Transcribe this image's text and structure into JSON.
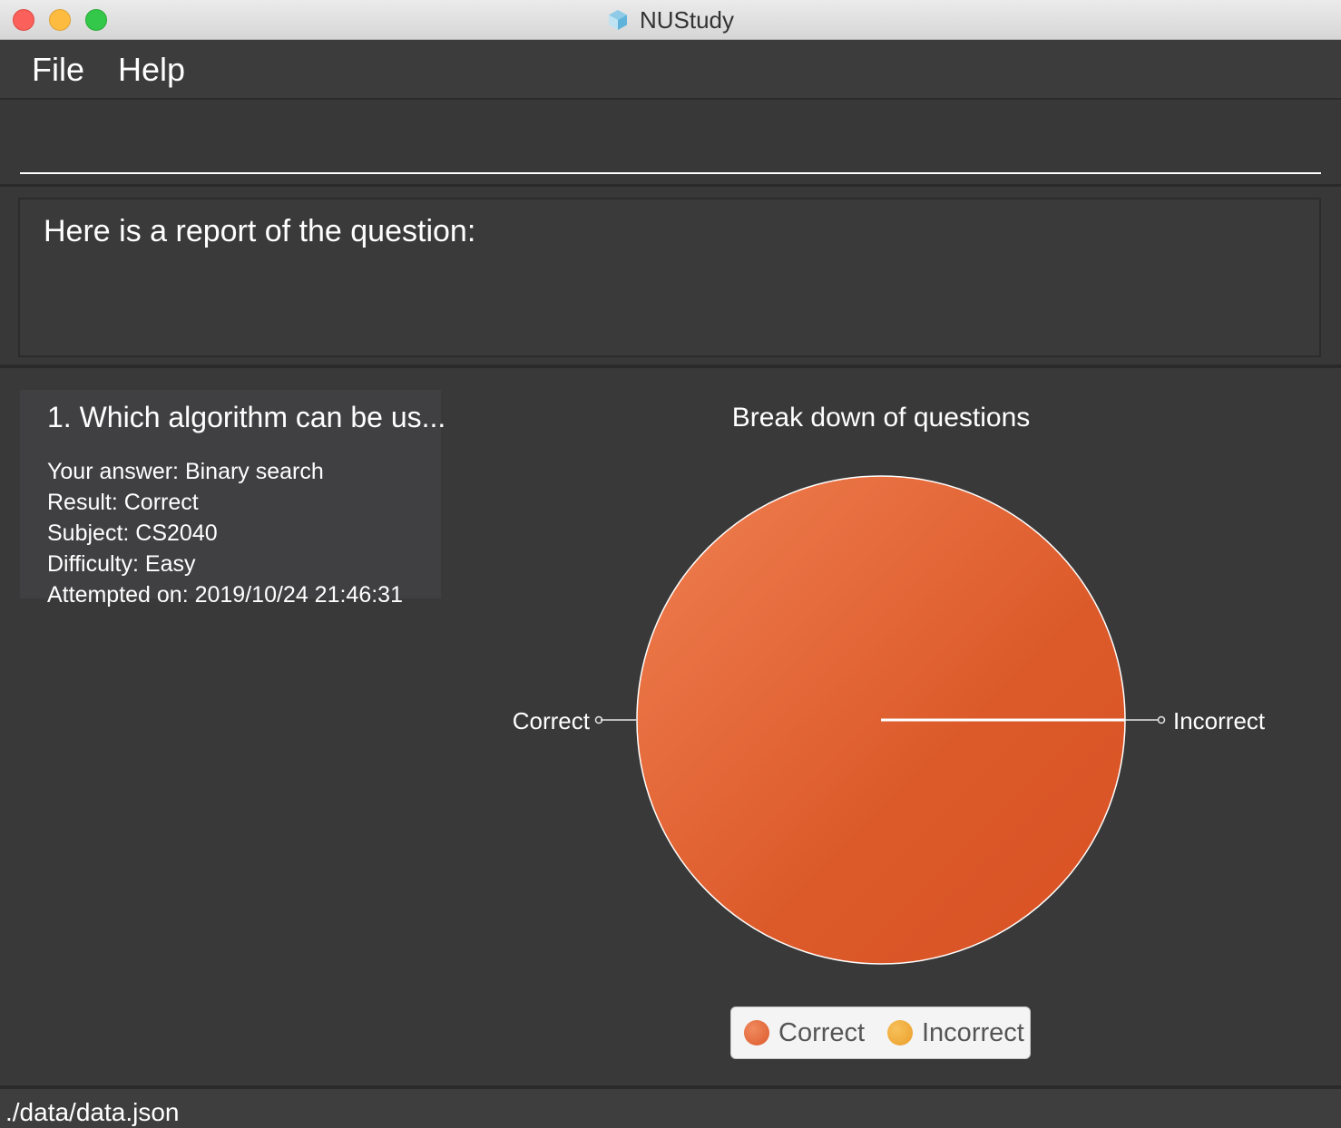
{
  "window": {
    "title": "NUStudy",
    "app_icon": "nustudy-app-icon"
  },
  "menu": {
    "file_label": "File",
    "help_label": "Help"
  },
  "command": {
    "value": "",
    "placeholder": ""
  },
  "result": {
    "message": "Here is a report of the question:"
  },
  "question": {
    "index_title": "1.  Which algorithm can be us...",
    "answer": "Your answer: Binary search",
    "result": "Result: Correct",
    "subject": "Subject: CS2040",
    "difficulty": "Difficulty: Easy",
    "attempted": "Attempted on: 2019/10/24 21:46:31"
  },
  "chart_data": {
    "type": "pie",
    "title": "Break down of questions",
    "slices": [
      {
        "label": "Correct",
        "value": 1,
        "color": "#e25f33"
      },
      {
        "label": "Incorrect",
        "value": 0,
        "color": "#f0a534"
      }
    ],
    "legend": [
      "Correct",
      "Incorrect"
    ],
    "legend_position": "bottom"
  },
  "status": {
    "path": "./data/data.json"
  },
  "colors": {
    "background": "#3a3a3a",
    "accent_correct": "#e25f33",
    "accent_incorrect": "#f0a534"
  }
}
